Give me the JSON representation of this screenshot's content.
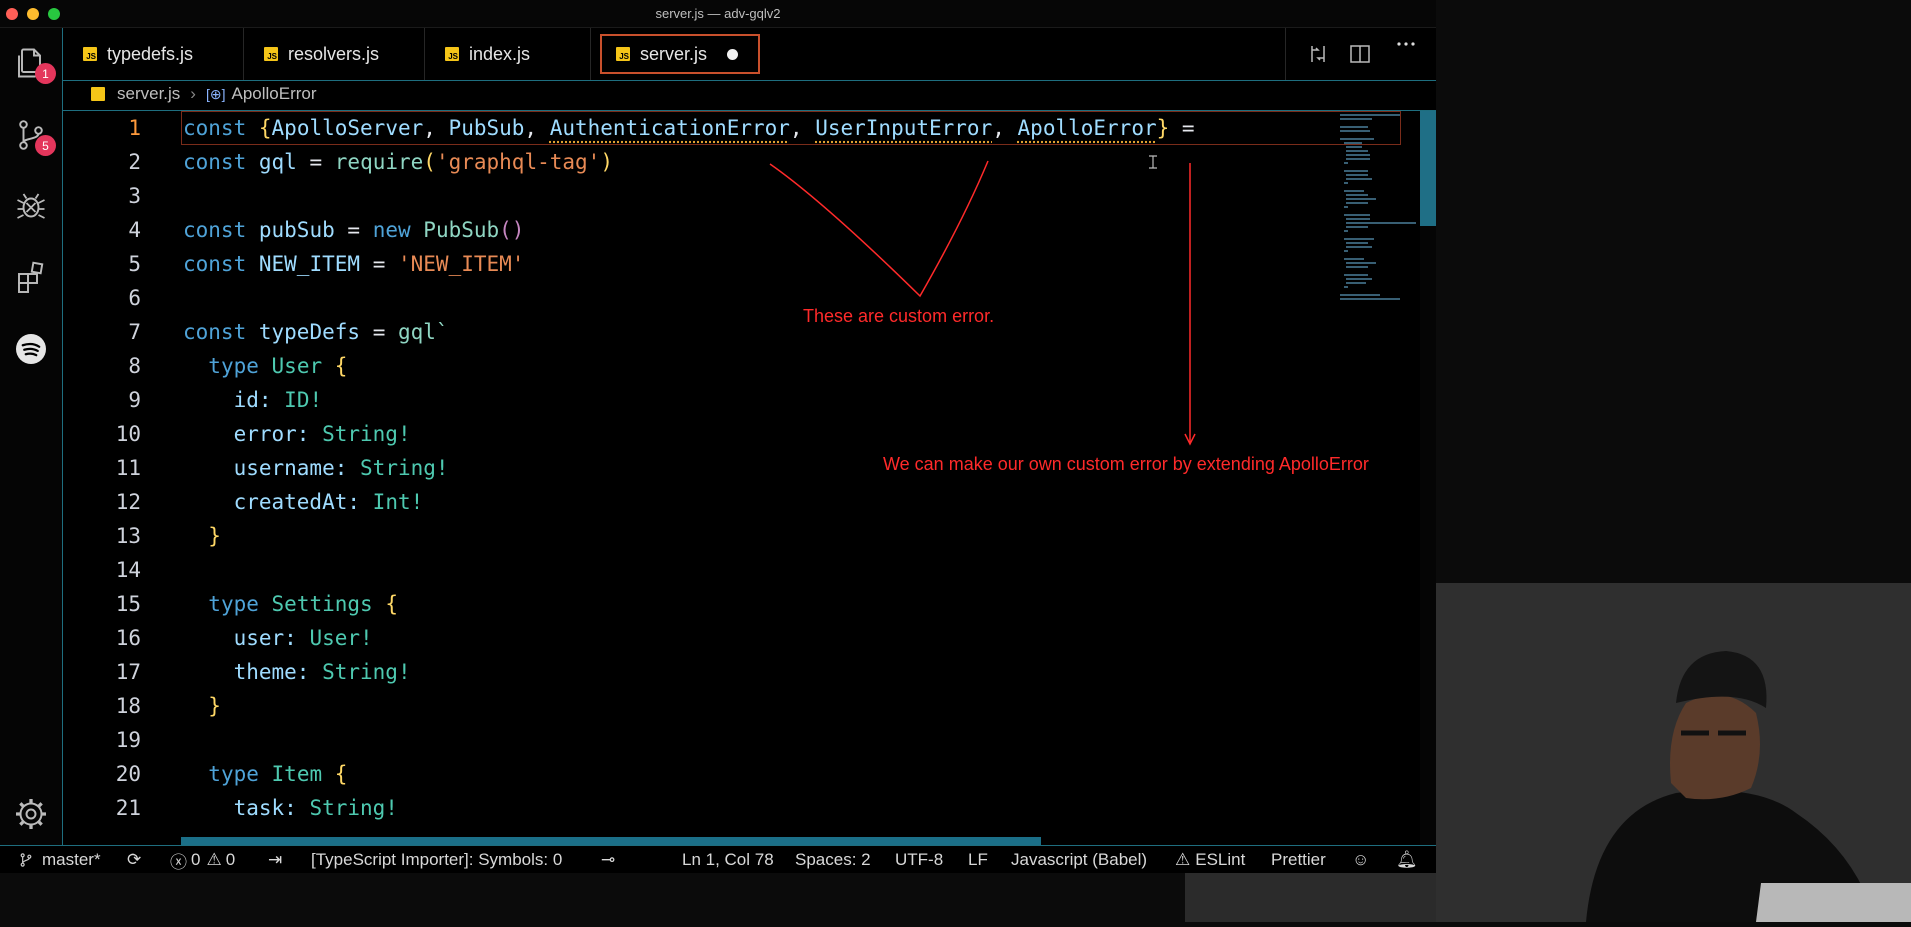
{
  "window": {
    "title": "server.js — adv-gqlv2"
  },
  "activity": {
    "explorer_badge": "1",
    "scm_badge": "5"
  },
  "tabs": [
    {
      "label": "typedefs.js"
    },
    {
      "label": "resolvers.js"
    },
    {
      "label": "index.js"
    },
    {
      "label": "server.js"
    }
  ],
  "breadcrumb": {
    "file": "server.js",
    "symbol": "ApolloError"
  },
  "code": {
    "lines": [
      "1",
      "2",
      "3",
      "4",
      "5",
      "6",
      "7",
      "8",
      "9",
      "10",
      "11",
      "12",
      "13",
      "14",
      "15",
      "16",
      "17",
      "18",
      "19",
      "20",
      "21"
    ],
    "l1": {
      "kw": "const",
      "open": "{",
      "a": "ApolloServer",
      "b": "PubSub",
      "c": "AuthenticationError",
      "d": "UserInputError",
      "e": "ApolloError",
      "close": "}",
      "eq": "="
    },
    "l2": {
      "kw": "const",
      "name": "gql",
      "eq": "=",
      "fn": "require",
      "str": "'graphql-tag'"
    },
    "l4": {
      "kw": "const",
      "name": "pubSub",
      "eq": "=",
      "new": "new",
      "cls": "PubSub"
    },
    "l5": {
      "kw": "const",
      "name": "NEW_ITEM",
      "eq": "=",
      "str": "'NEW_ITEM'"
    },
    "l7": {
      "kw": "const",
      "name": "typeDefs",
      "eq": "=",
      "tag": "gql`"
    },
    "l8": {
      "kw": "type",
      "name": "User",
      "brace": "{"
    },
    "l9": {
      "field": "id:",
      "type": "ID!"
    },
    "l10": {
      "field": "error:",
      "type": "String!"
    },
    "l11": {
      "field": "username:",
      "type": "String!"
    },
    "l12": {
      "field": "createdAt:",
      "type": "Int!"
    },
    "l13": {
      "brace": "}"
    },
    "l15": {
      "kw": "type",
      "name": "Settings",
      "brace": "{"
    },
    "l16": {
      "field": "user:",
      "type": "User!"
    },
    "l17": {
      "field": "theme:",
      "type": "String!"
    },
    "l18": {
      "brace": "}"
    },
    "l20": {
      "kw": "type",
      "name": "Item",
      "brace": "{"
    },
    "l21": {
      "field": "task:",
      "type": "String!"
    }
  },
  "annotations": {
    "custom": "These are custom error.",
    "extend": "We can make our own custom error by extending ApolloError"
  },
  "status": {
    "branch": "master*",
    "errors": "0",
    "warnings": "0",
    "importer": "[TypeScript Importer]: Symbols: 0",
    "position": "Ln 1, Col 78",
    "spaces": "Spaces: 2",
    "encoding": "UTF-8",
    "eol": "LF",
    "language": "Javascript (Babel)",
    "eslint": "ESLint",
    "prettier": "Prettier"
  },
  "colors": {
    "accent": "#1e6e7f",
    "annotation": "#ff2a2a",
    "badge": "#e4365c"
  }
}
